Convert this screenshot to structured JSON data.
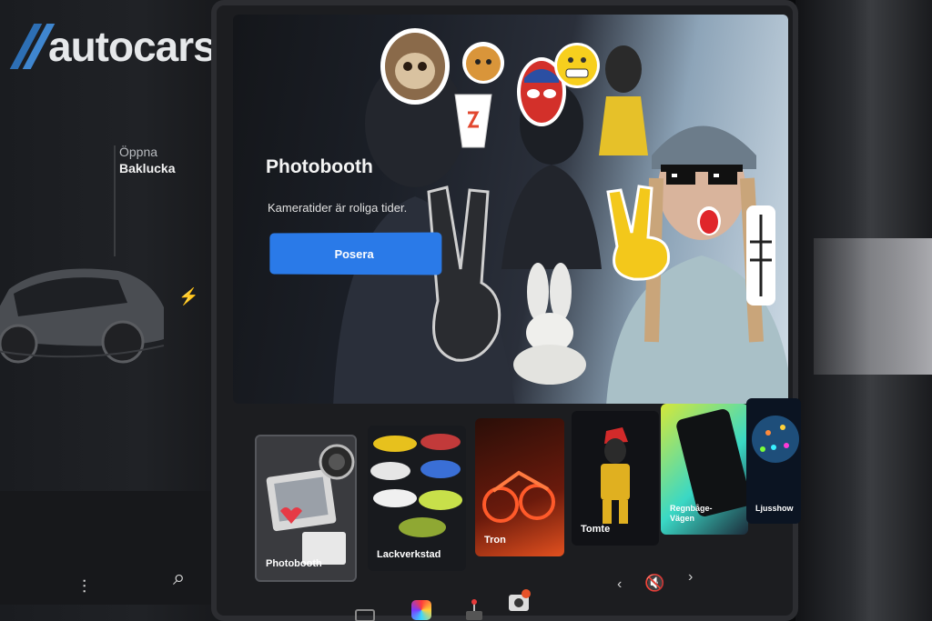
{
  "brand": {
    "name": "autocars",
    "registered": "®"
  },
  "left_panel": {
    "trunk_line1": "Öppna",
    "trunk_line2": "Baklucka",
    "charge_icon": "⚡"
  },
  "hero": {
    "title": "Photobooth",
    "subtitle": "Kameratider är roliga tider.",
    "button_label": "Posera"
  },
  "thumbnails": [
    {
      "label": "Photobooth",
      "icon": "camera-icon"
    },
    {
      "label": "Lackverkstad",
      "icon": "cars-icon"
    },
    {
      "label": "Tron",
      "icon": "motorcycle-icon"
    },
    {
      "label": "Tomte",
      "icon": "santa-icon"
    },
    {
      "label": "Regnbåge-Vägen",
      "icon": "rainbow-icon"
    },
    {
      "label": "Ljusshow",
      "icon": "lights-icon"
    }
  ],
  "statusbar": {
    "prev": "‹",
    "next": "›",
    "mute": "🔇"
  },
  "left_dock": {
    "equalizer": "⫶",
    "search": "⌕"
  }
}
